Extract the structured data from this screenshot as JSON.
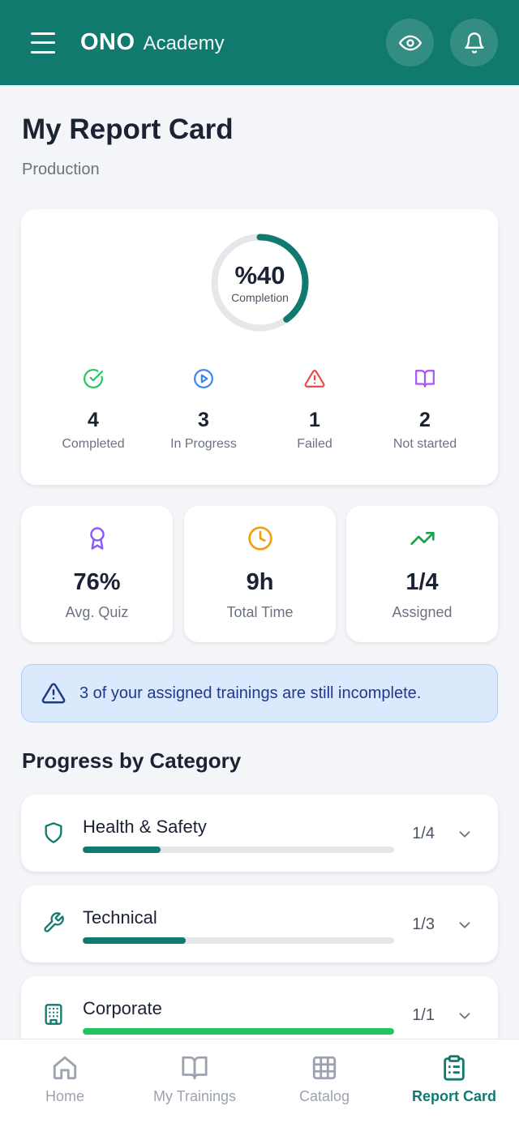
{
  "header": {
    "brand_bold": "ONO",
    "brand_rest": "Academy",
    "menu_icon": "hamburger-icon",
    "view_icon": "eye-icon",
    "notify_icon": "bell-icon"
  },
  "page": {
    "title": "My Report Card",
    "subtitle": "Production"
  },
  "completion": {
    "percent_label": "%40",
    "percent_value": 40,
    "label": "Completion",
    "ring_color": "#117a6e",
    "track_color": "#e5e7eb"
  },
  "status": [
    {
      "value": "4",
      "label": "Completed",
      "icon": "check-circle-icon",
      "color": "#22c55e"
    },
    {
      "value": "3",
      "label": "In Progress",
      "icon": "play-circle-icon",
      "color": "#3b82f6"
    },
    {
      "value": "1",
      "label": "Failed",
      "icon": "warning-icon",
      "color": "#ef4444"
    },
    {
      "value": "2",
      "label": "Not started",
      "icon": "book-icon",
      "color": "#a855f7"
    }
  ],
  "metrics": [
    {
      "value": "76%",
      "label": "Avg. Quiz",
      "icon": "award-icon",
      "color": "#8b5cf6"
    },
    {
      "value": "9h",
      "label": "Total Time",
      "icon": "clock-icon",
      "color": "#f59e0b"
    },
    {
      "value": "1/4",
      "label": "Assigned",
      "icon": "trending-up-icon",
      "color": "#16a34a"
    }
  ],
  "alert": {
    "text": "3 of your assigned trainings are still incomplete.",
    "icon": "warning-icon"
  },
  "section_title": "Progress by Category",
  "categories": [
    {
      "name": "Health & Safety",
      "count": "1/4",
      "progress": 0.25,
      "icon": "shield-icon",
      "fill_color": "#117a6e"
    },
    {
      "name": "Technical",
      "count": "1/3",
      "progress": 0.33,
      "icon": "wrench-icon",
      "fill_color": "#117a6e"
    },
    {
      "name": "Corporate",
      "count": "1/1",
      "progress": 1.0,
      "icon": "building-icon",
      "fill_color": "#22c55e"
    }
  ],
  "nav": [
    {
      "label": "Home",
      "icon": "home-icon",
      "active": false
    },
    {
      "label": "My Trainings",
      "icon": "book-open-icon",
      "active": false
    },
    {
      "label": "Catalog",
      "icon": "grid-icon",
      "active": false
    },
    {
      "label": "Report Card",
      "icon": "clipboard-icon",
      "active": true
    }
  ]
}
